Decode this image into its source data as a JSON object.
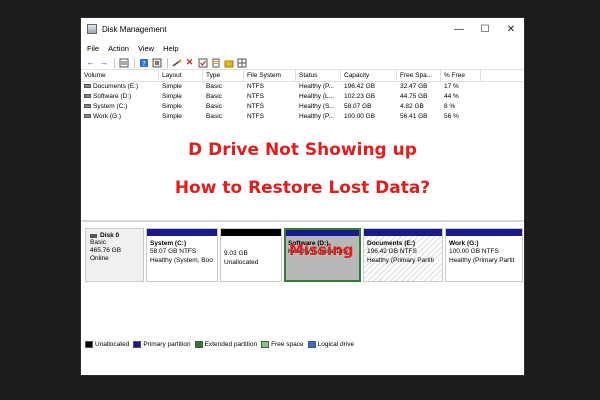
{
  "window": {
    "title": "Disk Management"
  },
  "window_controls": {
    "minimize": "—",
    "maximize": "☐",
    "close": "✕"
  },
  "menu": [
    "File",
    "Action",
    "View",
    "Help"
  ],
  "table": {
    "columns": [
      "Volume",
      "Layout",
      "Type",
      "File System",
      "Status",
      "Capacity",
      "Free Spa...",
      "% Free"
    ],
    "rows": [
      [
        "Documents (E:)",
        "Simple",
        "Basic",
        "NTFS",
        "Healthy (P...",
        "196.42 GB",
        "32.47 GB",
        "17 %"
      ],
      [
        "Software (D:)",
        "Simple",
        "Basic",
        "NTFS",
        "Healthy (L...",
        "102.23 GB",
        "44.75 GB",
        "44 %"
      ],
      [
        "System (C:)",
        "Simple",
        "Basic",
        "NTFS",
        "Healthy (S...",
        "58.07 GB",
        "4.82 GB",
        "8 %"
      ],
      [
        "Work (G:)",
        "Simple",
        "Basic",
        "NTFS",
        "Healthy (P...",
        "100.00 GB",
        "56.41 GB",
        "56 %"
      ]
    ]
  },
  "overlay": {
    "headline1": "D Drive Not Showing up",
    "headline2": "How to Restore Lost Data?",
    "missing": "Missing"
  },
  "disk": {
    "name": "Disk 0",
    "type": "Basic",
    "size": "465.76 GB",
    "status": "Online"
  },
  "partitions": [
    {
      "name": "System  (C:)",
      "size": "58.07 GB NTFS",
      "status": "Healthy (System, Boo"
    },
    {
      "name": "",
      "size": "9.03 GB",
      "status": "Unallocated"
    },
    {
      "name": "Software  (D:)",
      "size": "",
      "status": "Healthy (Logical Driv"
    },
    {
      "name": "Documents  (E:)",
      "size": "196.42 GB NTFS",
      "status": "Healthy (Primary Partiti"
    },
    {
      "name": "Work  (G:)",
      "size": "100.00 GB NTFS",
      "status": "Healthy (Primary Partit"
    }
  ],
  "legend": [
    "Unallocated",
    "Primary partition",
    "Extended partition",
    "Free space",
    "Logical drive"
  ],
  "colors": {
    "headline": "#e31c1c",
    "primary": "#1a1a8c",
    "unallocated": "#000000",
    "extended": "#2e7d32",
    "free_space": "#7ccd7c",
    "logical": "#2f6fd6"
  },
  "icons": [
    "back-icon",
    "forward-icon",
    "list-icon",
    "help-icon",
    "refresh-icon",
    "delete-icon",
    "check-icon",
    "properties-icon",
    "folder-icon",
    "grid-icon"
  ]
}
